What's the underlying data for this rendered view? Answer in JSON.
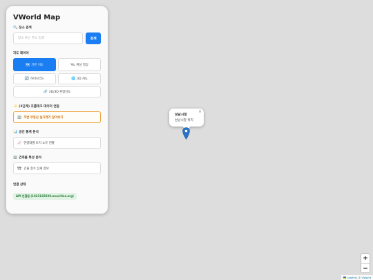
{
  "panel": {
    "title": "VWorld Map",
    "search": {
      "label": "장소 검색",
      "placeholder": "장소 또는 주소 입력",
      "button_label": "검색"
    },
    "layers": {
      "label": "지도 레이어",
      "items": [
        {
          "label": "기본 지도",
          "icon": "map-icon",
          "active": true
        },
        {
          "label": "위성 영상",
          "icon": "satellite-icon",
          "active": false
        },
        {
          "label": "하이브리드",
          "icon": "hybrid-icon",
          "active": false
        },
        {
          "label": "3D 지도",
          "icon": "globe-icon",
          "active": false
        },
        {
          "label": "2D/3D 혼합지도",
          "icon": "link-icon",
          "active": false
        }
      ]
    },
    "data_link": {
      "label": "(2단계) 프롭테크 데이터 연동",
      "button_label": "주변 부동산 실거래가 알아보기"
    },
    "stats": {
      "label": "공간 통계 분석",
      "button_label": "연령대별 토지 소유 현황"
    },
    "building": {
      "label": "건축물 특성 분석",
      "button_label": "건물 층수 상세 정보"
    },
    "connection": {
      "label": "연결 상태",
      "status": "API 연결됨 (1023165039.neocities.org)"
    }
  },
  "popup": {
    "title": "성남시청",
    "subtitle": "성남시청 위치"
  },
  "zoom": {
    "in": "+",
    "out": "−"
  },
  "attribution": {
    "flag": "🇺🇦",
    "leaflet": "Leaflet",
    "separator": " | © ",
    "vworld": "VWorld"
  },
  "colors": {
    "accent": "#1a7ef2",
    "warn": "#f0a640",
    "ok_bg": "#e1f3e4",
    "ok_text": "#2b7a3a",
    "marker": "#2b74c7"
  }
}
